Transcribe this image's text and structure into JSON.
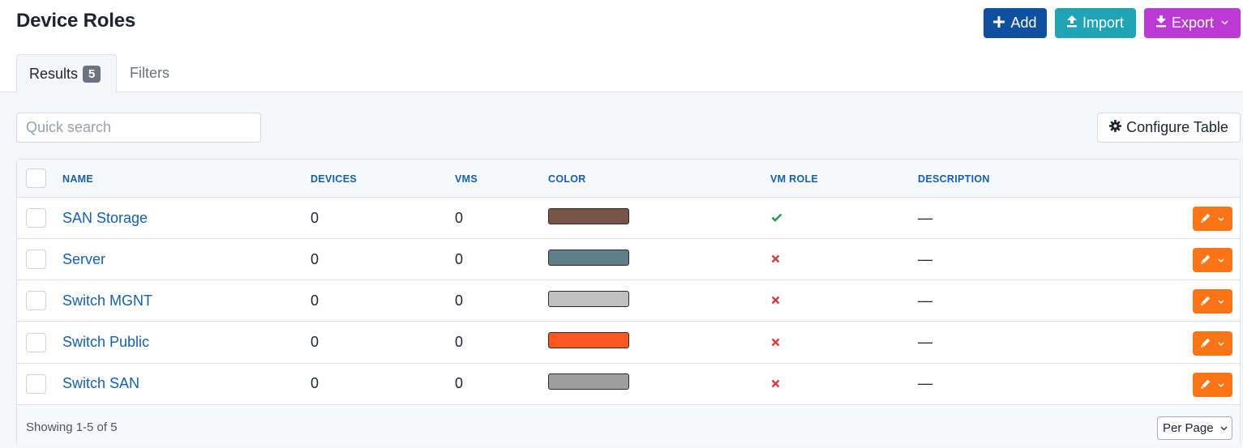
{
  "page": {
    "title": "Device Roles"
  },
  "actions": {
    "add": "Add",
    "import": "Import",
    "export": "Export"
  },
  "tabs": {
    "results": "Results",
    "results_count": "5",
    "filters": "Filters"
  },
  "search": {
    "placeholder": "Quick search",
    "value": ""
  },
  "configure_table": "Configure Table",
  "table": {
    "columns": [
      "NAME",
      "DEVICES",
      "VMS",
      "COLOR",
      "VM ROLE",
      "DESCRIPTION"
    ],
    "rows": [
      {
        "name": "SAN Storage",
        "devices": "0",
        "vms": "0",
        "color": "#795548",
        "vm_role": true,
        "description": "—"
      },
      {
        "name": "Server",
        "devices": "0",
        "vms": "0",
        "color": "#607d8b",
        "vm_role": false,
        "description": "—"
      },
      {
        "name": "Switch MGNT",
        "devices": "0",
        "vms": "0",
        "color": "#c0c0c0",
        "vm_role": false,
        "description": "—"
      },
      {
        "name": "Switch Public",
        "devices": "0",
        "vms": "0",
        "color": "#ff5722",
        "vm_role": false,
        "description": "—"
      },
      {
        "name": "Switch SAN",
        "devices": "0",
        "vms": "0",
        "color": "#9e9e9e",
        "vm_role": false,
        "description": "—"
      }
    ]
  },
  "footer": {
    "showing": "Showing 1-5 of 5",
    "per_page": "Per Page"
  },
  "icons": {
    "add": "plus-icon",
    "import": "upload-icon",
    "export": "download-icon",
    "configure": "gear-icon",
    "edit": "pencil-icon",
    "vm_role_true": "check-icon",
    "vm_role_false": "x-icon"
  },
  "theme": {
    "primary": "#0f4fa0",
    "import": "#1fa3b5",
    "export": "#bb3ad6",
    "edit_button": "#fb7517",
    "link": "#1460ad",
    "success": "#21a04a",
    "danger": "#d63a3a"
  }
}
